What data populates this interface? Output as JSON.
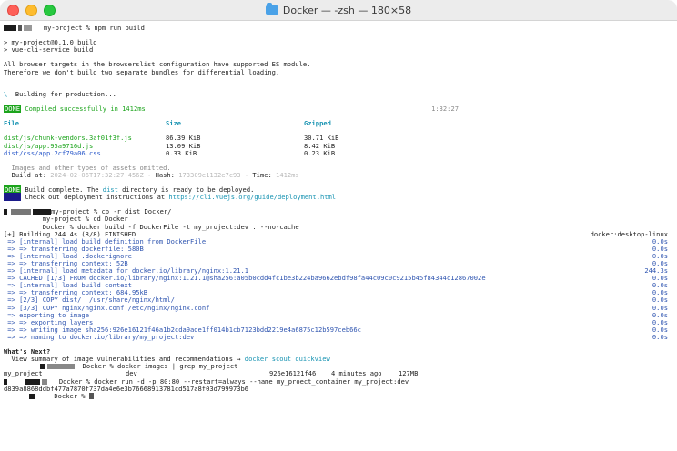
{
  "window": {
    "title": "Docker — -zsh — 180×58"
  },
  "lines": {
    "l1": "my-project % npm run build",
    "l2": "> my-project@0.1.0 build",
    "l3": "> vue-cli-service build",
    "l4": "All browser targets in the browserslist configuration have supported ES module.",
    "l5": "Therefore we don't build two separate bundles for differential loading.",
    "l6_spinner": "\\",
    "l6": "Building for production...",
    "done1_badge": "DONE",
    "done1_text": "Compiled successfully in 1412ms",
    "done1_time": "1:32:27",
    "hdr_file": "File",
    "hdr_size": "Size",
    "hdr_gzip": "Gzipped",
    "f1": "dist/js/chunk-vendors.3af01f3f.js",
    "f1_size": "86.39 KiB",
    "f1_gzip": "30.71 KiB",
    "f2": "dist/js/app.95a9716d.js",
    "f2_size": "13.09 KiB",
    "f2_gzip": "8.42 KiB",
    "f3": "dist/css/app.2cf79a06.css",
    "f3_size": "0.33 KiB",
    "f3_gzip": "0.23 KiB",
    "omit": "Images and other types of assets omitted.",
    "build_at_label": "Build at:",
    "build_at_val": "2024-02-06T17:32:27.456Z",
    "hash_label": "- Hash:",
    "hash_val": "173309e1132e7c93",
    "time_label": "- Time:",
    "time_val": "1412ms",
    "done2_badge": "DONE",
    "done2_a": "Build complete. The ",
    "done2_dist": "dist",
    "done2_b": " directory is ready to be deployed.",
    "info_badge": "INFO",
    "info_a": "Check out deployment instructions at ",
    "info_url": "https://cli.vuejs.org/guide/deployment.html",
    "cmd_cp": "my-project % cp -r dist Docker/",
    "cmd_cd": "my-project % cd Docker",
    "cmd_build": "Docker % docker build -f DockerFile -t my_project:dev . --no-cache",
    "bk_head": "[+] Building 244.4s (8/8) FINISHED",
    "bk_head_right": "docker:desktop-linux",
    "b1": "=> [internal] load build definition from DockerFile",
    "b1_t": "0.0s",
    "b2": "=> => transferring dockerfile: 580B",
    "b2_t": "0.0s",
    "b3": "=> [internal] load .dockerignore",
    "b3_t": "0.0s",
    "b4": "=> => transferring context: 52B",
    "b4_t": "0.0s",
    "b5": "=> [internal] load metadata for docker.io/library/nginx:1.21.1",
    "b5_t": "244.3s",
    "b6": "=> CACHED [1/3] FROM docker.io/library/nginx:1.21.1@sha256:a05b0cdd4fc1be3b224ba9662ebdf98fa44c09c0c9215b45f84344c12867002e",
    "b6_t": "0.0s",
    "b7": "=> [internal] load build context",
    "b7_t": "0.0s",
    "b8": "=> => transferring context: 684.95kB",
    "b8_t": "0.0s",
    "b9": "=> [2/3] COPY dist/  /usr/share/nginx/html/",
    "b9_t": "0.0s",
    "b10": "=> [3/3] COPY nginx/nginx.conf /etc/nginx/nginx.conf",
    "b10_t": "0.0s",
    "b11": "=> exporting to image",
    "b11_t": "0.0s",
    "b12": "=> => exporting layers",
    "b12_t": "0.0s",
    "b13": "=> => writing image sha256:926e16121f46a1b2cda9ade1ff014b1cb7123bdd2219e4a6875c12b597ceb66c",
    "b13_t": "0.0s",
    "b14": "=> => naming to docker.io/library/my_project:dev",
    "b14_t": "0.0s",
    "whats_next": "What's Next?",
    "view_a": "  View summary of image vulnerabilities and recommendations → ",
    "view_cmd": "docker scout quickview",
    "cmd_images": "Docker % docker images | grep my_project",
    "img_repo": "my_project",
    "img_tag": "dev",
    "img_id": "926e16121f46",
    "img_created": "4 minutes ago",
    "img_size": "127MB",
    "cmd_run": "Docker % docker run -d -p 80:80 --restart=always --name my_proect_container my_project:dev",
    "run_id": "d839a8868ddbf477a7870f737da4e6e3b76668913781cd517a8f03d799973b6",
    "prompt_last": "Docker %"
  }
}
